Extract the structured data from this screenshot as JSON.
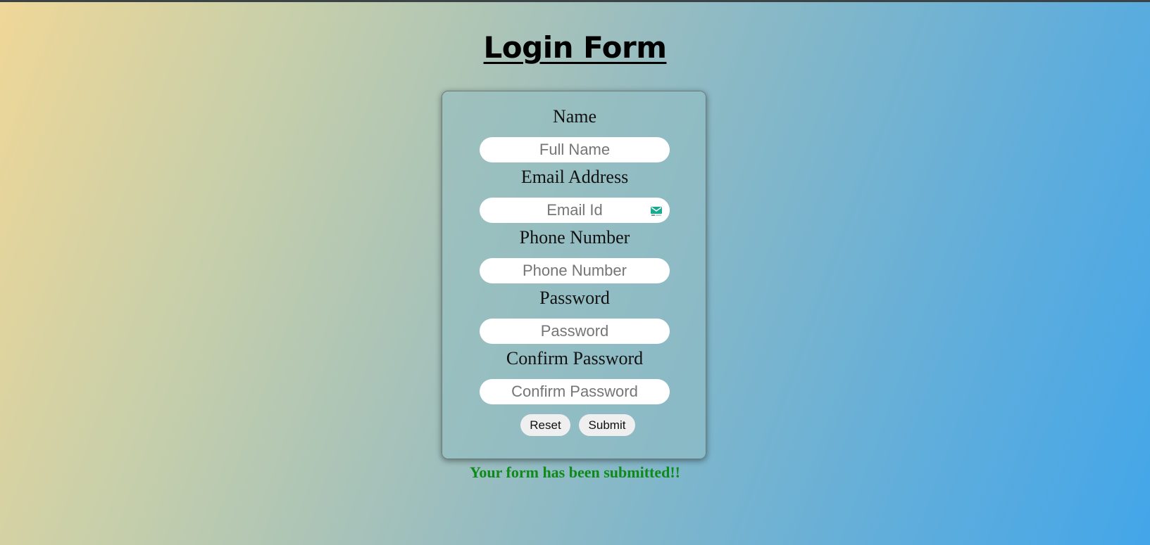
{
  "page": {
    "title": "Login Form"
  },
  "form": {
    "fields": [
      {
        "label": "Name",
        "placeholder": "Full Name",
        "type": "text"
      },
      {
        "label": "Email Address",
        "placeholder": "Email Id",
        "type": "email",
        "icon": "mail-icon"
      },
      {
        "label": "Phone Number",
        "placeholder": "Phone Number",
        "type": "tel"
      },
      {
        "label": "Password",
        "placeholder": "Password",
        "type": "password"
      },
      {
        "label": "Confirm Password",
        "placeholder": "Confirm Password",
        "type": "password"
      }
    ],
    "buttons": {
      "reset_label": "Reset",
      "submit_label": "Submit"
    }
  },
  "status": {
    "message": "Your form has been submitted!!",
    "color": "#0d8a17"
  },
  "colors": {
    "gradient_start": "#efd797",
    "gradient_end": "#43a6e9",
    "mail_icon": "#19a98f"
  }
}
